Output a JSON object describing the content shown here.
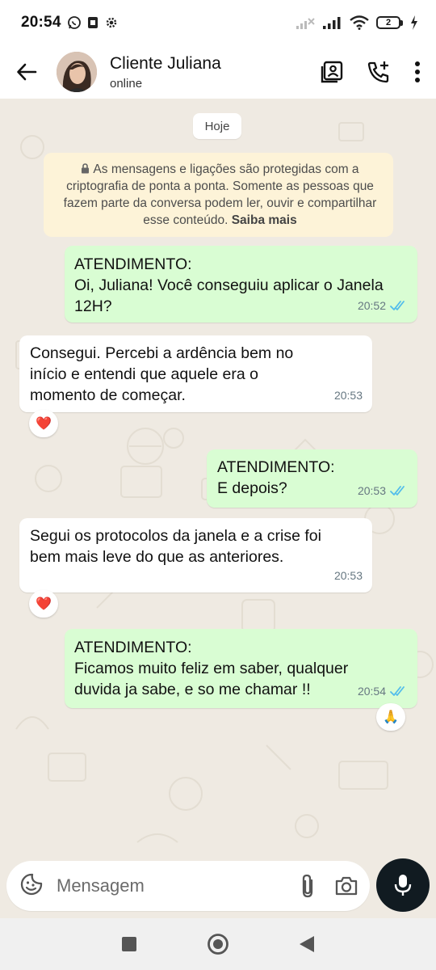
{
  "status_bar": {
    "time": "20:54",
    "battery_level": "2"
  },
  "header": {
    "contact_name": "Cliente Juliana",
    "contact_status": "online"
  },
  "chat": {
    "date_label": "Hoje",
    "encryption_notice": "As mensagens e ligações são protegidas com a criptografia de ponta a ponta. Somente as pessoas que fazem parte da conversa podem ler, ouvir e compartilhar esse conteúdo.",
    "encryption_link": "Saiba mais",
    "messages": [
      {
        "direction": "out",
        "text": "ATENDIMENTO:\nOi, Juliana! Você conseguiu aplicar o Janela 12H?",
        "time": "20:52",
        "read": true
      },
      {
        "direction": "in",
        "text": "Consegui. Percebi a ardência bem no início e entendi que aquele era o momento de começar.",
        "time": "20:53",
        "reaction": "❤️"
      },
      {
        "direction": "out",
        "text": "ATENDIMENTO:\nE depois?",
        "time": "20:53",
        "read": true
      },
      {
        "direction": "in",
        "text": "Segui os protocolos da janela e a crise foi bem mais leve do que as anteriores.",
        "time": "20:53",
        "reaction": "❤️"
      },
      {
        "direction": "out",
        "text": "ATENDIMENTO:\nFicamos muito feliz em saber, qualquer duvida ja sabe, e so me chamar !!",
        "time": "20:54",
        "read": true,
        "reaction": "🙏"
      }
    ]
  },
  "composer": {
    "placeholder": "Mensagem"
  },
  "icons": {
    "back": "arrow-left-icon",
    "contact_card": "contact-card-icon",
    "add_call": "phone-plus-icon",
    "menu": "more-vert-icon",
    "emoji": "sticker-icon",
    "attach": "paperclip-icon",
    "camera": "camera-icon",
    "mic": "microphone-icon",
    "read_receipt": "double-check-icon"
  },
  "colors": {
    "chat_background": "#efeae2",
    "outgoing_bubble": "#d9fdd3",
    "incoming_bubble": "#ffffff",
    "read_receipt": "#53bdeb",
    "notice_background": "#fdf3d8",
    "mic_button": "#111b21"
  }
}
